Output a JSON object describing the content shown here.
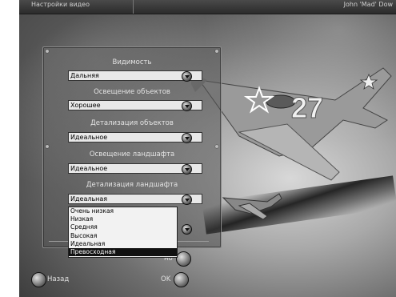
{
  "window": {
    "title": "Настройки видео",
    "user": "John 'Mad' Dow"
  },
  "settings": [
    {
      "label": "Видимость",
      "value": "Дальняя"
    },
    {
      "label": "Освещение объектов",
      "value": "Хорошее"
    },
    {
      "label": "Детализация объектов",
      "value": "Идеальное"
    },
    {
      "label": "Освещение ландшафта",
      "value": "Идеальное"
    },
    {
      "label": "Детализация ландшафта",
      "value": "Идеальная"
    }
  ],
  "open_list": {
    "options": [
      "Очень низкая",
      "Низкая",
      "Средняя",
      "Высокая",
      "Идеальная",
      "Превосходная"
    ],
    "selected": "Превосходная"
  },
  "footer": {
    "back_label": "Назад",
    "ok_label": "OK",
    "apply_partial": "но"
  },
  "aircraft": {
    "number": "27"
  }
}
